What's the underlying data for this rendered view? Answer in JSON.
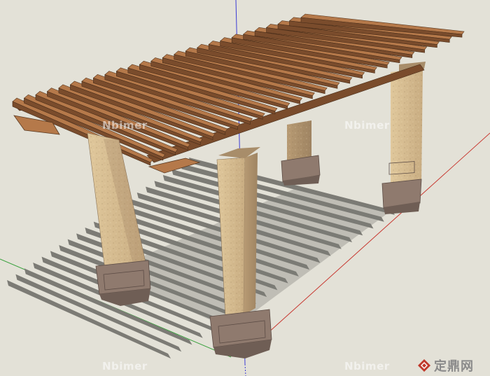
{
  "watermarks": {
    "tl": "Nbimer",
    "tr": "Nbimer",
    "bl": "Nbimer",
    "br": "Nbimer"
  },
  "brand": {
    "text": "定鼎网",
    "logo": "diamond-logo-icon"
  },
  "colors": {
    "background": "#e3e1d7",
    "shadow": "#7c7b75",
    "beam_top": "#b5794a",
    "beam_side": "#7a4c2c",
    "column_light": "#d6be93",
    "column_dark": "#a88d6a",
    "base": "#8f7a6e",
    "axis_blue": "#3b3bd6",
    "axis_red": "#c83a32",
    "axis_green": "#36a03a"
  }
}
